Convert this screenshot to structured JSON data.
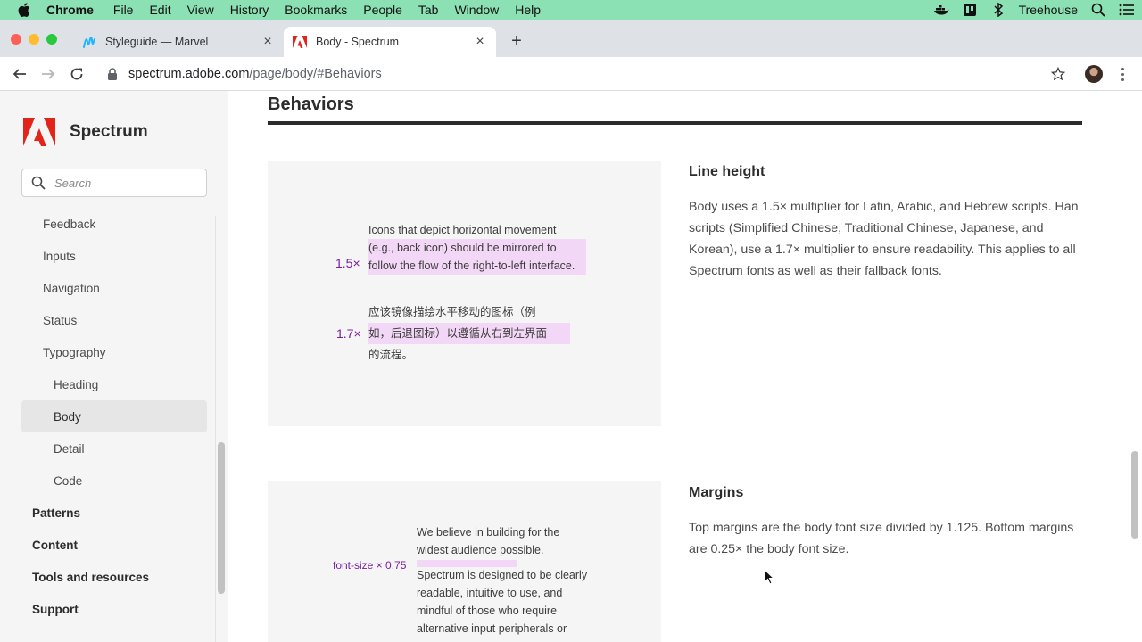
{
  "menubar": {
    "app": "Chrome",
    "items": [
      "File",
      "Edit",
      "View",
      "History",
      "Bookmarks",
      "People",
      "Tab",
      "Window",
      "Help"
    ],
    "profile": "Treehouse",
    "status_icons": [
      "docker-icon",
      "codepen-icon",
      "bluetooth-icon",
      "spotlight-icon",
      "list-icon"
    ]
  },
  "tabs": [
    {
      "title": "Styleguide — Marvel",
      "favicon": "marvel-icon",
      "active": false
    },
    {
      "title": "Body - Spectrum",
      "favicon": "adobe-icon",
      "active": true
    }
  ],
  "address": {
    "host": "spectrum.adobe.com",
    "path": "/page/body/#Behaviors"
  },
  "sidebar": {
    "brand": "Spectrum",
    "search_placeholder": "Search",
    "items": [
      {
        "label": "Feedback",
        "level": 1,
        "selected": false
      },
      {
        "label": "Inputs",
        "level": 1,
        "selected": false
      },
      {
        "label": "Navigation",
        "level": 1,
        "selected": false
      },
      {
        "label": "Status",
        "level": 1,
        "selected": false
      },
      {
        "label": "Typography",
        "level": 1,
        "selected": false
      },
      {
        "label": "Heading",
        "level": 2,
        "selected": false
      },
      {
        "label": "Body",
        "level": 2,
        "selected": true
      },
      {
        "label": "Detail",
        "level": 2,
        "selected": false
      },
      {
        "label": "Code",
        "level": 2,
        "selected": false
      },
      {
        "label": "Patterns",
        "level": 0,
        "selected": false
      },
      {
        "label": "Content",
        "level": 0,
        "selected": false
      },
      {
        "label": "Tools and resources",
        "level": 0,
        "selected": false
      },
      {
        "label": "Support",
        "level": 0,
        "selected": false
      }
    ]
  },
  "main": {
    "section_title": "Behaviors",
    "line_height": {
      "title": "Line height",
      "description": "Body uses a 1.5× multiplier for Latin, Arabic, and Hebrew scripts. Han scripts (Simplified Chinese, Traditional Chinese, Japanese, and Korean), use a 1.7× multiplier to ensure readability. This applies to all Spectrum fonts as well as their fallback fonts.",
      "latin_multiplier": "1.5×",
      "latin_line1": "Icons that depict horizontal movement",
      "latin_line2": "(e.g., back icon) should be mirrored to",
      "latin_line3": "follow the flow of the right-to-left interface.",
      "han_multiplier": "1.7×",
      "han_line1": "应该镜像描绘水平移动的图标（例",
      "han_line2": "如，后退图标）以遵循从右到左界面",
      "han_line3": "的流程。"
    },
    "margins": {
      "title": "Margins",
      "description": "Top margins are the body font size divided by 1.125. Bottom margins are 0.25× the body font size.",
      "label": "font-size × 0.75",
      "para1_line1": "We believe in building for the",
      "para1_line2": "widest audience possible.",
      "para2_line1": "Spectrum is designed to be clearly",
      "para2_line2": "readable, intuitive to use, and",
      "para2_line3": "mindful of those who require",
      "para2_line4": "alternative input peripherals or"
    }
  },
  "colors": {
    "menubar": "#8be0b4",
    "accent_purple": "#7a1ea1",
    "highlight": "#f3d7f6",
    "adobe_red": "#e1251b"
  }
}
